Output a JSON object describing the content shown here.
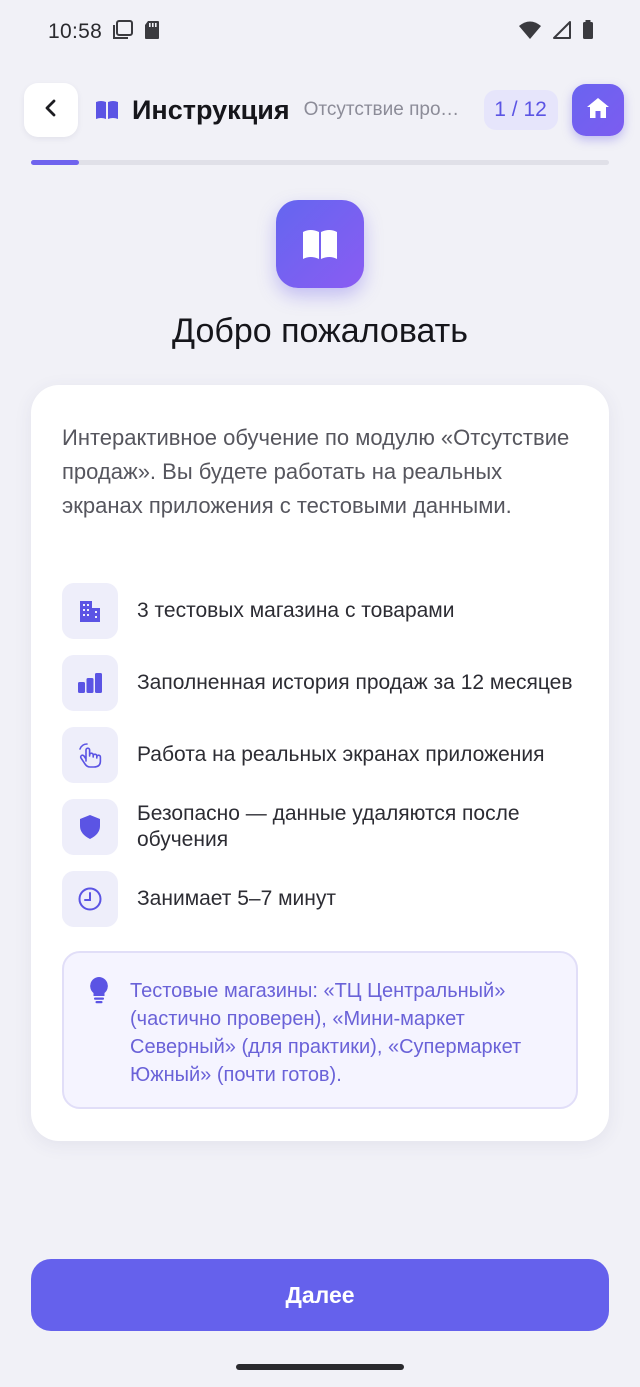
{
  "status_bar": {
    "time": "10:58"
  },
  "header": {
    "title": "Инструкция",
    "subtitle": "Отсутствие продаж",
    "step": "1 / 12",
    "back_icon": "chevron-left-icon",
    "title_icon": "book-icon",
    "home_icon": "home-icon"
  },
  "progress": {
    "current": 1,
    "total": 12
  },
  "hero": {
    "icon": "book-icon",
    "title": "Добро пожаловать"
  },
  "card": {
    "intro": "Интерактивное обучение по модулю «Отсутствие продаж». Вы будете работать на реальных экранах приложения с тестовыми данными.",
    "features": [
      {
        "icon": "buildings-icon",
        "text": "3 тестовых магазина с товарами"
      },
      {
        "icon": "bar-chart-icon",
        "text": "Заполненная история продаж за 12 месяцев"
      },
      {
        "icon": "hand-tap-icon",
        "text": "Работа на реальных экранах приложения"
      },
      {
        "icon": "shield-icon",
        "text": "Безопасно — данные удаляются после обучения"
      },
      {
        "icon": "clock-icon",
        "text": "Занимает 5–7 минут"
      }
    ],
    "tip": {
      "icon": "lightbulb-icon",
      "text": "Тестовые магазины: «ТЦ Центральный» (частично проверен), «Мини-маркет Северный» (для практики), «Супермаркет Южный» (почти готов)."
    }
  },
  "footer": {
    "next_label": "Далее"
  },
  "colors": {
    "accent": "#6561ec",
    "accent_light": "#e6e5fb",
    "background": "#f1f1f7",
    "tip_text": "#6a62d8"
  }
}
